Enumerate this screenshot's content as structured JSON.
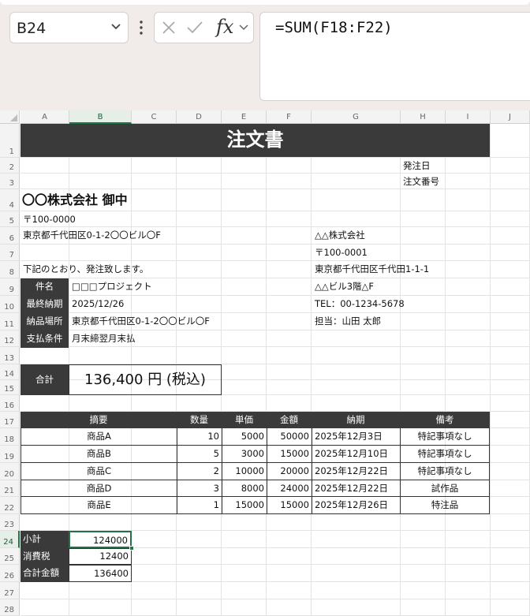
{
  "formula_bar": {
    "name_box": "B24",
    "fx_label": "fx",
    "formula": "=SUM(F18:F22)"
  },
  "columns": [
    "A",
    "B",
    "C",
    "D",
    "E",
    "F",
    "G",
    "H",
    "I",
    "J"
  ],
  "rows": [
    "1",
    "2",
    "3",
    "4",
    "5",
    "6",
    "7",
    "8",
    "9",
    "10",
    "11",
    "12",
    "13",
    "14",
    "15",
    "16",
    "17",
    "18",
    "19",
    "20",
    "21",
    "22",
    "23",
    "24",
    "25",
    "26",
    "27",
    "28"
  ],
  "doc": {
    "title": "注文書",
    "order_date_label": "発注日",
    "order_no_label": "注文番号",
    "recipient": "〇〇株式会社 御中",
    "recipient_zip": "〒100-0000",
    "recipient_addr": "東京都千代田区0-1-2〇〇ビル〇F",
    "intro": "下記のとおり、発注致します。",
    "sender": {
      "company": "△△株式会社",
      "zip": "〒100-0001",
      "addr1": "東京都千代田区千代田1-1-1",
      "addr2": "△△ビル3階△F",
      "tel": "TEL：00-1234-5678",
      "person": "担当：山田 太郎"
    },
    "info": [
      {
        "label": "件名",
        "value": "□□□プロジェクト"
      },
      {
        "label": "最終納期",
        "value": "2025/12/26"
      },
      {
        "label": "納品場所",
        "value": "東京都千代田区0-1-2〇〇ビル〇F"
      },
      {
        "label": "支払条件",
        "value": "月末締翌月末払"
      }
    ],
    "total_label": "合計",
    "total_value": "136,400 円 (税込)",
    "table_headers": {
      "summary": "摘要",
      "qty": "数量",
      "price": "単価",
      "amount": "金額",
      "due": "納期",
      "note": "備考"
    },
    "items": [
      {
        "name": "商品A",
        "qty": "10",
        "price": "5000",
        "amount": "50000",
        "due": "2025年12月3日",
        "note": "特記事項なし"
      },
      {
        "name": "商品B",
        "qty": "5",
        "price": "3000",
        "amount": "15000",
        "due": "2025年12月10日",
        "note": "特記事項なし"
      },
      {
        "name": "商品C",
        "qty": "2",
        "price": "10000",
        "amount": "20000",
        "due": "2025年12月22日",
        "note": "特記事項なし"
      },
      {
        "name": "商品D",
        "qty": "3",
        "price": "8000",
        "amount": "24000",
        "due": "2025年12月22日",
        "note": "試作品"
      },
      {
        "name": "商品E",
        "qty": "1",
        "price": "15000",
        "amount": "15000",
        "due": "2025年12月26日",
        "note": "特注品"
      }
    ],
    "summary": [
      {
        "label": "小計",
        "value": "124000"
      },
      {
        "label": "消費税",
        "value": "12400"
      },
      {
        "label": "合計金額",
        "value": "136400"
      }
    ]
  },
  "colors": {
    "accent": "#217346",
    "header_fill": "#3a3a3a"
  }
}
